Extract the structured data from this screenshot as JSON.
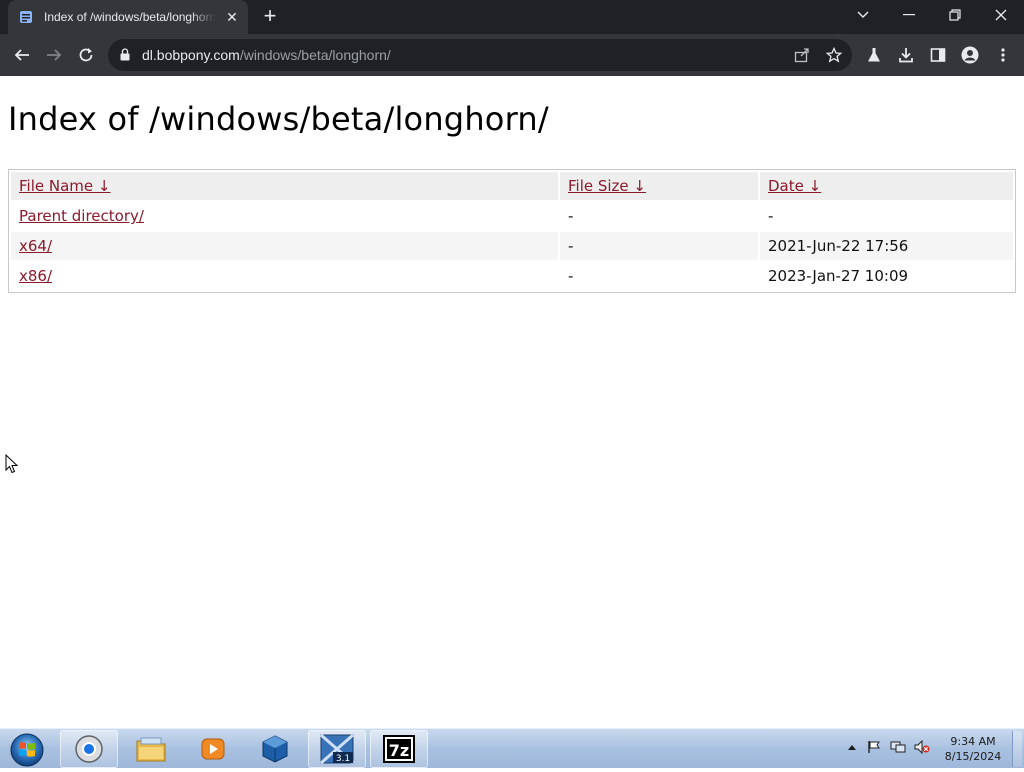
{
  "browser": {
    "tab_title": "Index of /windows/beta/longhorn/",
    "url_domain": "dl.bobpony.com",
    "url_path": "/windows/beta/longhorn/"
  },
  "page": {
    "heading": "Index of /windows/beta/longhorn/",
    "columns": {
      "name": "File Name ↓",
      "size": "File Size ↓",
      "date": "Date ↓"
    },
    "rows": [
      {
        "name": "Parent directory/",
        "size": "-",
        "date": "-"
      },
      {
        "name": "x64/",
        "size": "-",
        "date": "2021-Jun-22 17:56"
      },
      {
        "name": "x86/",
        "size": "-",
        "date": "2023-Jan-27 10:09"
      }
    ]
  },
  "taskbar": {
    "clock_time": "9:34 AM",
    "clock_date": "8/15/2024",
    "items": [
      "chrome-icon",
      "explorer-icon",
      "media-player-icon",
      "virtualbox-icon",
      "vmware-icon",
      "7zip-icon"
    ],
    "vmware_badge": "3.1",
    "sevenzip_label": "7z"
  },
  "colors": {
    "link": "#8b1a2b",
    "chrome_dark": "#202124",
    "chrome_toolbar": "#35363a"
  }
}
